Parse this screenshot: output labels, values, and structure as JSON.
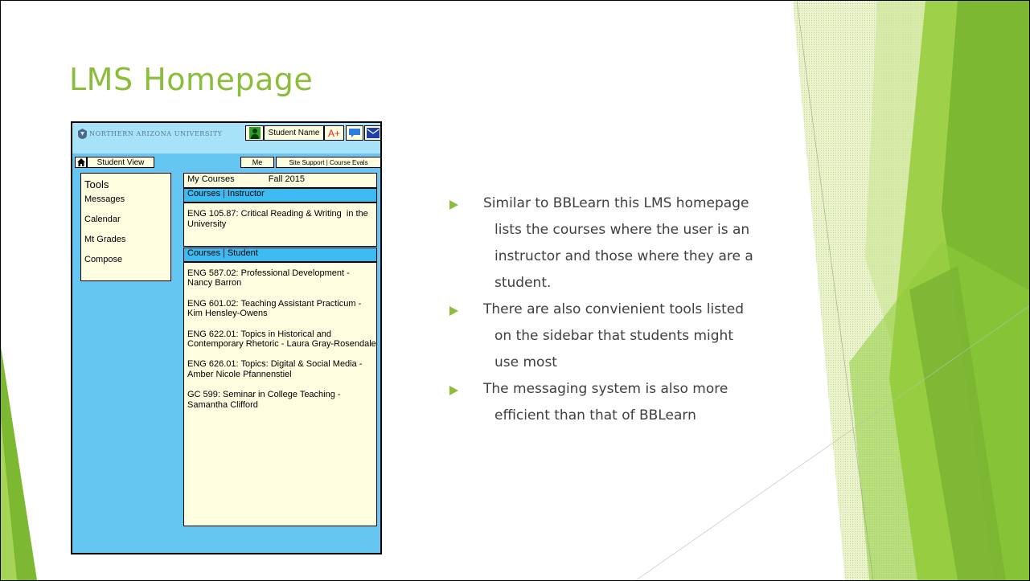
{
  "slide": {
    "title": "LMS Homepage",
    "accent_color": "#8bbd3a",
    "bullets": [
      {
        "lines": [
          "Similar to BBLearn this LMS homepage",
          "lists the courses where the user is an",
          "instructor and those where they are a",
          "student."
        ]
      },
      {
        "lines": [
          "There are also convienient tools listed",
          "on the sidebar that students might",
          "use most"
        ]
      },
      {
        "lines": [
          "The messaging system is also more",
          "efficient than that of BBLearn"
        ]
      }
    ]
  },
  "mockup": {
    "colors": {
      "background": "#66c6f2",
      "header": "#a8e2f8",
      "panel": "#fffde0",
      "section_bar": "#3cbbf2"
    },
    "logo_text": "NORTHERN ARIZONA UNIVERSITY",
    "header": {
      "person_icon": "person-icon",
      "student_name": "Student Name",
      "grade_label": "A+",
      "chat_icon": "chat-icon",
      "mail_icon": "mail-icon"
    },
    "nav": {
      "home_icon": "home-icon",
      "student_view": "Student View",
      "me": "Me",
      "site_support": "Site Support | Course Evals"
    },
    "tools": {
      "heading": "Tools",
      "items": [
        "Messages",
        "Calendar",
        "Mt Grades",
        "Compose"
      ]
    },
    "courses": {
      "title": "My Courses",
      "term": "Fall 2015",
      "instructor_header": "Courses | Instructor",
      "instructor_courses": [
        "ENG 105.87: Critical Reading & Writing  in the University"
      ],
      "student_header": "Courses | Student",
      "student_courses": [
        "ENG 587.02: Professional Development - Nancy Barron",
        "ENG 601.02: Teaching Assistant Practicum - Kim Hensley-Owens",
        "ENG 622.01: Topics in Historical and Contemporary Rhetoric - Laura Gray-Rosendale",
        "ENG 626.01: Topics: Digital & Social Media - Amber Nicole Pfannenstiel",
        "GC 599: Seminar in College Teaching - Samantha Clifford"
      ]
    }
  }
}
